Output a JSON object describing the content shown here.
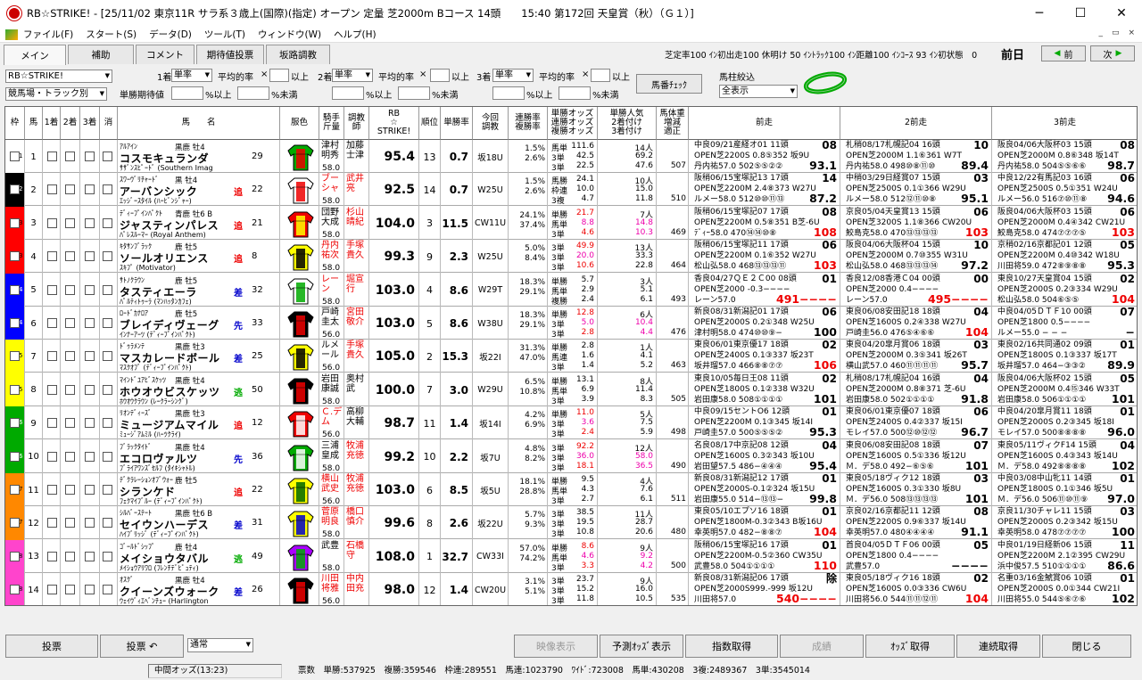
{
  "window": {
    "title": "RB☆STRIKE! - [25/11/02 東京11R サラ系３歳上(国際)(指定) オープン 定量 芝2000m Bコース 14頭　　15:40 第172回 天皇賞（秋）（Ｇ１）]"
  },
  "menu": [
    "ファイル(F)",
    "スタート(S)",
    "データ(D)",
    "ツール(T)",
    "ウィンドウ(W)",
    "ヘルプ(H)"
  ],
  "tabs": [
    "メイン",
    "補助",
    "コメント",
    "期待値投票",
    "坂路調教"
  ],
  "status_counts": "芝定率100 ｲﾝ初出走100 休明け 50 ｲﾝﾄﾗｯｸ100 ｲﾝ距離100 ｲﾝｺｰｽ 93 ｲﾝ初状態　0",
  "prev_day": "前日",
  "nav": {
    "prev": "前",
    "next": "次"
  },
  "controls": {
    "profile": "RB☆STRIKE!",
    "track": "競馬場・トラック別",
    "place1": "1着",
    "place2": "2着",
    "place3": "3着",
    "bet1": "単率",
    "bet2": "単率",
    "bet3": "単率",
    "avg_label": "平均的率",
    "x": "×",
    "above": "以上",
    "ev_label": "単勝期待値",
    "pct_above": "%以上",
    "pct_below": "%未満",
    "horse_check": "馬番ﾁｪｯｸ",
    "filter_label": "馬柱絞込",
    "filter_value": "全表示"
  },
  "headers": {
    "waku": "枠",
    "uma": "馬",
    "p1": "1着",
    "p2": "2着",
    "p3": "3着",
    "del": "消",
    "name": "馬　　名",
    "silk": "服色",
    "jockey": "騎手\n斤量",
    "trainer": "調教\n師",
    "rb": "RB\n☆\nSTRIKE!",
    "rank": "順位",
    "win": "単勝率",
    "train": "今回\n調教",
    "rate": "連勝率\n複勝率",
    "odds": "単勝オッズ\n連勝オッズ\n複勝オッズ",
    "pop": "単勝人気\n2着付け\n3着付け",
    "weight": "馬体重\n増減\n適正",
    "prev1": "前走",
    "prev2": "2前走",
    "prev3": "3前走"
  },
  "colors": {
    "waku1": "#ffffff",
    "waku2": "#000000",
    "waku3": "#ff0000",
    "waku4": "#0000ff",
    "waku5": "#ffff00",
    "waku6": "#00aa00",
    "waku7": "#ff8800",
    "waku8": "#ff44cc"
  },
  "horses": [
    {
      "waku": "1",
      "num": "1",
      "sire": "ｱﾙｱｲﾝ",
      "sex": "黒鹿 牡4",
      "name": "コスモキュランダ",
      "dam": "ｻｻﾞﾝｽﾋﾟｰﾄﾞ (Southern Imag",
      "bend": "",
      "age": "29",
      "jk": "津村明秀",
      "jw": "58.0",
      "tr": "加藤士津",
      "rb": "95.4",
      "rank": "13",
      "win": "0.7",
      "train": "坂18U",
      "r1": "1.5%",
      "r2": "2.6%",
      "o1": "馬単",
      "o1v": "111.6",
      "o2": "3単",
      "o2v": "42.5",
      "o3": "3単",
      "o3v": "22.5",
      "p1": "14人",
      "p2v": "69.2",
      "p3v": "47.6",
      "wt": "507",
      "pv1": [
        "中良09/21産経オ01 11頭 08",
        "OPEN芝2200S 0.8⑤352 坂9U",
        "丹内祐57.0 502⑤⑤②② 93.1"
      ],
      "pv2": [
        "札稍08/17札幌記04 16頭 10",
        "OPEN芝2000M 1.1⑥361 W7T",
        "丹内祐58.0 498⑩⑧⑪⑩ 89.4"
      ],
      "pv3": [
        "阪良04/06大阪杯03 15頭 08",
        "OPEN芝2000M 0.8⑥348 坂14T",
        "丹内祐58.0 504⑤⑤⑥⑥ 98.7"
      ]
    },
    {
      "waku": "2",
      "num": "2",
      "sire": "ｽﾜｰｳﾞﾘﾁｬｰﾄﾞ",
      "sex": "黒 牡4",
      "name": "アーバンシック",
      "dam": "ｴｯｼﾞｰｽﾀｲﾙ (ﾊｰﾋﾞﾝｼﾞｬｰ)",
      "bend": "追",
      "age": "22",
      "jk": "ブーシャ",
      "jw": "58.0",
      "tr": "武井亮",
      "rb": "92.5",
      "rank": "14",
      "win": "0.7",
      "train": "W25U",
      "r1": "1.5%",
      "r2": "2.6%",
      "o1": "馬勝",
      "o1v": "24.1",
      "o2": "枠連",
      "o2v": "10.0",
      "o3": "3複",
      "o3v": "4.7",
      "p1": "10人",
      "p2v": "15.0",
      "p3v": "11.8",
      "wt": "510",
      "pv1": [
        "阪稍06/15宝塚記13 17頭 14",
        "OPEN芝2200M 2.4⑧373 W27U",
        "ルメー58.0 512⑩⑩⑪⑬ 87.2"
      ],
      "pv2": [
        "中稍03/29日経賞07 15頭 03",
        "OPEN芝2500S 0.1①366 W29U",
        "ルメー58.0 512⑫⑪⑩⑧ 95.1"
      ],
      "pv3": [
        "中良12/22有馬記03 16頭 06",
        "OPEN芝2500S 0.5①351 W24U",
        "ルメー56.0 516⑦⑩⑪⑧ 94.6"
      ]
    },
    {
      "waku": "3",
      "num": "3",
      "sire": "ﾃﾞｨｰﾌﾟｲﾝﾊﾟｸﾄ",
      "sex": "青鹿 牡6 B",
      "name": "ジャスティンパレス",
      "dam": "ﾊﾟﾚｽﾙｰﾏｰ (Royal Anthem)",
      "bend": "追",
      "age": "21",
      "jk": "団野大成",
      "jw": "58.0",
      "tr": "杉山晴紀",
      "rb": "104.0",
      "rank": "3",
      "win": "11.5",
      "train": "CW11U",
      "r1": "24.1%",
      "r2": "37.4%",
      "o1": "単勝",
      "o1v": "21.7",
      "o2": "馬単",
      "o2v": "8.8",
      "o3": "3単",
      "o3v": "4.6",
      "p1": "7人",
      "p2v": "14.8",
      "p3v": "10.3",
      "wt": "469",
      "pv1": [
        "阪稍06/15宝塚記07 17頭 08",
        "OPEN芝2200M 0.5⑧351 B芝-6U",
        "ﾃﾞｨｰ58.0 470⑭⑭⑩⑧ 108"
      ],
      "pv2": [
        "京良05/04天皇賞13 15頭 06",
        "OPEN芝3200S 1.1⑧366 CW20U",
        "鮫島克58.0 470⑬⑬⑬⑬ 103"
      ],
      "pv3": [
        "阪良04/06大阪杯03 15頭 06",
        "OPEN芝2000M 0.4④342 CW21U",
        "鮫島克58.0 474⑦⑦⑦⑤ 103"
      ]
    },
    {
      "waku": "3",
      "num": "4",
      "sire": "ｷﾀｻﾝﾌﾞﾗｯｸ",
      "sex": "鹿 牡5",
      "name": "ソールオリエンス",
      "dam": "ｽｷﾌﾟ (Motivator)",
      "bend": "追",
      "age": "8",
      "jk": "丹内祐次",
      "jw": "58.0",
      "tr": "手塚貴久",
      "rb": "99.3",
      "rank": "9",
      "win": "2.3",
      "train": "W25U",
      "r1": "5.0%",
      "r2": "8.4%",
      "o1": "3単",
      "o1v": "49.9",
      "o2": "3単",
      "o2v": "20.0",
      "o3": "3単",
      "o3v": "10.6",
      "p1": "13人",
      "p2v": "33.3",
      "p3v": "22.8",
      "wt": "464",
      "pv1": [
        "阪稍06/15宝塚記11 17頭 06",
        "OPEN芝2200M 0.1⑥352 W27U",
        "松山弘58.0 468⑬⑬⑬⑪ 103"
      ],
      "pv2": [
        "阪良04/06大阪杯04 15頭 10",
        "OPEN芝2000M 0.7⑩355 W31U",
        "松山弘58.0 468⑬⑬⑬⑭ 97.2"
      ],
      "pv3": [
        "京稍02/16京都記01 12頭 05",
        "OPEN芝2200M 0.4⑩342 W18U",
        "川田将59.0 472⑧⑨⑧⑧ 95.3"
      ]
    },
    {
      "waku": "4",
      "num": "5",
      "sire": "ｻﾄﾉｸﾗｳﾝ",
      "sex": "鹿 牡5",
      "name": "タスティエーラ",
      "dam": "ﾊﾟﾙﾃｨﾄｩｰﾗ (ﾏﾝﾊｯﾀﾝｶﾌｪ)",
      "bend": "差",
      "age": "32",
      "jk": "レーン",
      "jw": "58.0",
      "tr": "堀宣行",
      "rb": "103.0",
      "rank": "4",
      "win": "8.6",
      "train": "W29T",
      "r1": "18.3%",
      "r2": "29.1%",
      "o1": "単勝",
      "o1v": "5.7",
      "o2": "馬単",
      "o2v": "2.9",
      "o3": "複勝",
      "o3v": "2.4",
      "p1": "3人",
      "p2v": "5.1",
      "p3v": "6.1",
      "wt": "493",
      "pv1": [
        "香良04/27ＱＥ２Ｃ00 08頭 01",
        "OPEN芝2000 -0.3−−−−",
        "レーン57.0 491−−−−"
      ],
      "pv2": [
        "香良12/08香港Ｃ04 00頭 00",
        "OPEN芝2000 0.4−−−−",
        "レーン57.0 495−−−−"
      ],
      "pv3": [
        "東良10/27天皇賞04 15頭 02",
        "OPEN芝2000S 0.2③334 W29U",
        "松山弘58.0 504⑥⑤⑤ 104"
      ]
    },
    {
      "waku": "4",
      "num": "6",
      "sire": "ﾛｰﾄﾞｶﾅﾛｱ",
      "sex": "鹿 牡5",
      "name": "ブレイディヴェーグ",
      "dam": "ｲﾝﾅｰｱｰﾂ (ﾃﾞｨｰﾌﾟｲﾝﾊﾟｸﾄ)",
      "bend": "先",
      "age": "33",
      "jk": "戸崎圭太",
      "jw": "56.0",
      "tr": "宮田敬介",
      "rb": "103.0",
      "rank": "5",
      "win": "8.6",
      "train": "W38U",
      "r1": "18.3%",
      "r2": "29.1%",
      "o1": "単勝",
      "o1v": "12.8",
      "o2": "3単",
      "o2v": "5.0",
      "o3": "3単",
      "o3v": "2.8",
      "p1": "6人",
      "p2v": "10.4",
      "p3v": "4.4",
      "wt": "476",
      "pv1": [
        "新良08/31新潟記01 17頭 06",
        "OPEN芝2000S 0.2①348 W25U",
        "津村明58.0 474⑩⑩⑨− 100"
      ],
      "pv2": [
        "東良06/08安田記18 18頭 04",
        "OPEN芝1600S 0.2④338 W27U",
        "戸崎圭56.0 476⑤④⑥⑥ 104"
      ],
      "pv3": [
        "中良04/05ＤＴＦ10 00頭 07",
        "OPEN芝1800 0.5−−−−",
        "ルメー55.0 − − − −"
      ]
    },
    {
      "waku": "5",
      "num": "7",
      "sire": "ﾄﾞｩﾗﾒﾝﾃ",
      "sex": "黒鹿 牡3",
      "name": "マスカレードボール",
      "dam": "ﾏｽｸｵﾌﾞ (ﾃﾞｨｰﾌﾟｲﾝﾊﾟｸﾄ)",
      "bend": "差",
      "age": "25",
      "jk": "ルメール",
      "jw": "56.0",
      "tr": "手塚貴久",
      "rb": "105.0",
      "rank": "2",
      "win": "15.3",
      "train": "坂22I",
      "r1": "31.3%",
      "r2": "47.0%",
      "o1": "単勝",
      "o1v": "2.8",
      "o2": "馬連",
      "o2v": "1.6",
      "o3": "3単",
      "o3v": "1.4",
      "p1": "1人",
      "p2v": "4.1",
      "p3v": "5.2",
      "wt": "463",
      "pv1": [
        "東良06/01東京優17 18頭 02",
        "OPEN芝2400S 0.1③337 坂23T",
        "坂井瑠57.0 466⑧⑧⑦⑦ 106"
      ],
      "pv2": [
        "東良04/20皐月賞06 18頭 03",
        "OPEN芝2000M 0.3⑤341 坂26T",
        "横山武57.0 460⑪⑪⑪⑪ 95.7"
      ],
      "pv3": [
        "東良02/16共同通02 09頭 01",
        "OPEN芝1800S 0.1③337 坂17T",
        "坂井瑠57.0 464−③③② 89.9"
      ]
    },
    {
      "waku": "5",
      "num": "8",
      "sire": "ﾏｲﾝﾄﾞﾕｱﾋﾞｽｹｯﾂ",
      "sex": "黒鹿 牡4",
      "name": "ホウオウビスケッツ",
      "dam": "ﾎｳｵｳｸﾗｳﾝ (ﾚｰｸﾗｰｼﾝｸﾞ)",
      "bend": "逃",
      "age": "50",
      "jk": "岩田康誠",
      "jw": "58.0",
      "tr": "奥村武",
      "rb": "100.0",
      "rank": "7",
      "win": "3.0",
      "train": "W29U",
      "r1": "6.5%",
      "r2": "10.8%",
      "o1": "単勝",
      "o1v": "13.1",
      "o2": "馬単",
      "o2v": "6.9",
      "o3": "3単",
      "o3v": "3.9",
      "p1": "8人",
      "p2v": "11.4",
      "p3v": "8.3",
      "wt": "505",
      "pv1": [
        "東良10/05毎日王08 11頭 02",
        "OPEN芝1800S 0.1②338 W32U",
        "岩田康58.0 508①①①① 101"
      ],
      "pv2": [
        "札稍08/17札幌記04 16頭 04",
        "OPEN芝2000M 0.8⑧371 芝-6U",
        "岩田康58.0 502①①①① 91.8"
      ],
      "pv3": [
        "阪良04/06大阪杯02 15頭 05",
        "OPEN芝2000M 0.4⑮346 W33T",
        "岩田康58.0 506①①①① 101"
      ]
    },
    {
      "waku": "6",
      "num": "9",
      "sire": "ﾘｵﾝﾃﾞｨｰｽﾞ",
      "sex": "黒鹿 牡3",
      "name": "ミュージアムマイル",
      "dam": "ﾐｭｰｼﾞｱﾑﾐﾙ (ﾊｰﾂｸﾗｲ)",
      "bend": "追",
      "age": "12",
      "jk": "Ｃ.デム",
      "jw": "56.0",
      "tr": "高柳大輔",
      "rb": "98.7",
      "rank": "11",
      "win": "1.4",
      "train": "坂14I",
      "r1": "4.2%",
      "r2": "6.9%",
      "o1": "単勝",
      "o1v": "11.0",
      "o2": "3単",
      "o2v": "3.6",
      "o3": "3単",
      "o3v": "2.4",
      "p1": "5人",
      "p2v": "7.5",
      "p3v": "5.9",
      "wt": "498",
      "pv1": [
        "中良09/15セントO6 12頭 01",
        "OPEN芝2200M 0.1③345 坂14I",
        "戸崎圭57.0 500⑤⑤⑤② 95.3"
      ],
      "pv2": [
        "東良06/01東京優07 18頭 06",
        "OPEN芝2400S 0.4②337 坂15I",
        "モレイ57.0 500⑫⑩⑫⑫ 96.7"
      ],
      "pv3": [
        "中良04/20皐月賞11 18頭 01",
        "OPEN芝2000S 0.2③345 坂18I",
        "モレイ57.0 500⑧⑧⑧⑧ 96.0"
      ]
    },
    {
      "waku": "6",
      "num": "10",
      "sire": "ﾌﾞﾗｯｸﾀｲﾄﾞ",
      "sex": "黒鹿 牡4",
      "name": "エコロヴァルツ",
      "dam": "ﾌﾞﾗｲｱﾜﾝｽﾞｾﾙﾌ (ﾀｲｷｼｬﾄﾙ)",
      "bend": "先",
      "age": "36",
      "jk": "三浦皇成",
      "jw": "58.0",
      "tr": "牧浦充徳",
      "rb": "99.2",
      "rank": "10",
      "win": "2.2",
      "train": "坂7U",
      "r1": "4.8%",
      "r2": "8.2%",
      "o1": "3単",
      "o1v": "92.2",
      "o2": "3単",
      "o2v": "36.0",
      "o3": "3単",
      "o3v": "18.1",
      "p1": "12人",
      "p2v": "58.0",
      "p3v": "36.5",
      "wt": "490",
      "pv1": [
        "名良08/17中京記08 12頭 04",
        "OPEN芝1600S 0.3②343 坂10U",
        "岩田望57.5 486−④④④ 95.4"
      ],
      "pv2": [
        "東良06/08安田記08 18頭 07",
        "OPEN芝1600S 0.5①336 坂12U",
        "Ｍ．デ58.0 492−⑥⑤⑥ 101"
      ],
      "pv3": [
        "東良05/11ヴィクF14 15頭 04",
        "OPEN芝1600S 0.4③343 坂14U",
        "Ｍ．デ58.0 492⑧⑧⑧⑧ 102"
      ]
    },
    {
      "waku": "7",
      "num": "11",
      "sire": "ﾃﾞｸﾗﾚｰｼｮﾝｵﾌﾞｳｫｰ",
      "sex": "鹿 牡5",
      "name": "シランケド",
      "dam": "ﾌｪｸﾏｲﾌﾞﾙｰ (ﾃﾞｨｰﾌﾟｲﾝﾊﾟｸﾄ)",
      "bend": "追",
      "age": "22",
      "jk": "横山武史",
      "jw": "56.0",
      "tr": "牧浦充徳",
      "rb": "103.0",
      "rank": "6",
      "win": "8.5",
      "train": "坂5U",
      "r1": "18.1%",
      "r2": "28.8%",
      "o1": "単勝",
      "o1v": "9.5",
      "o2": "馬単",
      "o2v": "4.3",
      "o3": "3単",
      "o3v": "2.7",
      "p1": "4人",
      "p2v": "7.6",
      "p3v": "6.1",
      "wt": "511",
      "pv1": [
        "新良08/31新潟記12 17頭 01",
        "OPEN芝2000S-0.1②324 坂15U",
        "岩田康55.0 514−⑬⑬− 99.8"
      ],
      "pv2": [
        "東良05/18ヴィク12 18頭 03",
        "OPEN芝1600S 0.3①330 坂8U",
        "Ｍ．デ56.0 508⑬⑬⑬⑬ 101"
      ],
      "pv3": [
        "中良03/08中山牝11 14頭 01",
        "OPEN芝1800S 0.1①346 坂5U",
        "Ｍ．デ56.0 506⑪⑩⑪⑨ 97.0"
      ]
    },
    {
      "waku": "7",
      "num": "12",
      "sire": "ｼﾙﾊﾞｰｽﾃｰﾄ",
      "sex": "黒鹿 牡6 B",
      "name": "セイウンハーデス",
      "dam": "ﾊｲﾌﾞﾘｯｼﾞ (ﾃﾞｨｰﾌﾟｲﾝﾊﾟｸﾄ)",
      "bend": "差",
      "age": "31",
      "jk": "菅原明良",
      "jw": "58.0",
      "tr": "橋口慎介",
      "rb": "99.6",
      "rank": "8",
      "win": "2.6",
      "train": "坂22U",
      "r1": "5.7%",
      "r2": "9.3%",
      "o1": "3単",
      "o1v": "38.5",
      "o2": "3単",
      "o2v": "19.5",
      "o3": "3単",
      "o3v": "10.8",
      "p1": "11人",
      "p2v": "28.7",
      "p3v": "20.6",
      "wt": "480",
      "pv1": [
        "東良05/10エプソ16 18頭 01",
        "OPEN芝1800M-0.3②343 B坂16U",
        "幸英明57.0 482−⑧⑧⑦ 104"
      ],
      "pv2": [
        "京良02/16京都記11 12頭 08",
        "OPEN芝2200S 0.9⑥337 坂14U",
        "幸英明57.0 480④④④④ 91.1"
      ],
      "pv3": [
        "京良11/30チャレ11 15頭 03",
        "OPEN芝2000S 0.2③342 坂15U",
        "幸英明58.0 478⑦⑦⑦⑦ 100"
      ]
    },
    {
      "waku": "8",
      "num": "13",
      "sire": "ｺﾞｰﾙﾄﾞｼｯﾌﾟ",
      "sex": "鹿 牡4",
      "name": "メイショウタバル",
      "dam": "ﾒｲｼｮｳｱﾘﾜﾛ (ﾌﾚﾝﾁﾃﾞﾋﾟｭﾃｨ)",
      "bend": "逃",
      "age": "49",
      "jk": "武豊",
      "jw": "58.0",
      "tr": "石橋守",
      "rb": "108.0",
      "rank": "1",
      "win": "32.7",
      "train": "CW33I",
      "r1": "57.0%",
      "r2": "74.2%",
      "o1": "単勝",
      "o1v": "8.6",
      "o2": "馬単",
      "o2v": "4.6",
      "o3": "3単",
      "o3v": "3.3",
      "p1": "9人",
      "p2v": "9.2",
      "p3v": "4.2",
      "wt": "500",
      "pv1": [
        "阪稍06/15宝塚記16 17頭 01",
        "OPEN芝2200M-0.5②360 CW35U",
        "武豊58.0 504①①①① 110"
      ],
      "pv2": [
        "首良04/05ＤＴＦ06 00頭 05",
        "OPEN芝1800 0.4−−−−",
        "武豊57.0 −−−−"
      ],
      "pv3": [
        "中良01/19日経新06 15頭 11",
        "OPEN芝2200M 2.1②395 CW29U",
        "浜中俊57.5 510①①①① 86.6"
      ]
    },
    {
      "waku": "8",
      "num": "14",
      "sire": "ｵｽｸﾞ",
      "sex": "黒鹿 牡4",
      "name": "クイーンズウォーク",
      "dam": "ｳｪｲｳﾞｨｴﾍﾞﾝﾁｭｰ (Harlington",
      "bend": "差",
      "age": "26",
      "jk": "川田将雅",
      "jw": "56.0",
      "tr": "中内田充",
      "rb": "98.0",
      "rank": "12",
      "win": "1.4",
      "train": "CW20U",
      "r1": "3.1%",
      "r2": "5.1%",
      "o1": "3単",
      "o1v": "23.7",
      "o2": "3単",
      "o2v": "15.2",
      "o3": "3単",
      "o3v": "11.8",
      "p1": "9人",
      "p2v": "16.0",
      "p3v": "10.5",
      "wt": "535",
      "pv1": [
        "新良08/31新潟記06 17頭 除",
        "OPEN芝2000S999.-999 坂12U",
        "川田将57.0 540−−−−"
      ],
      "pv2": [
        "東良05/18ヴィク16 18頭 02",
        "OPEN芝1600S 0.0③336 CW6U",
        "川田将56.0 544⑪⑪⑫⑪ 104"
      ],
      "pv3": [
        "名重03/16金鯱賞06 10頭 01",
        "OPEN芝2000S 0.0①344 CW21I",
        "川田将55.0 544⑤⑥⑦⑥ 102"
      ]
    }
  ],
  "bottom": {
    "vote": "投票",
    "vote2": "投票 ↶",
    "mode": "通常",
    "movie": "映像表示",
    "pred": "予測ｵｯｽﾞ表示",
    "idx": "指数取得",
    "result": "成績",
    "odds": "ｵｯｽﾞ取得",
    "cont": "連続取得",
    "close": "閉じる"
  },
  "status": {
    "mid": "中間オッズ(13:23)",
    "votes": "票数　単勝:537925　複勝:359546　枠連:289551　馬連:1023790　ﾜｲﾄﾞ:723008　馬単:430208　3複:2489367　3単:3545014"
  }
}
